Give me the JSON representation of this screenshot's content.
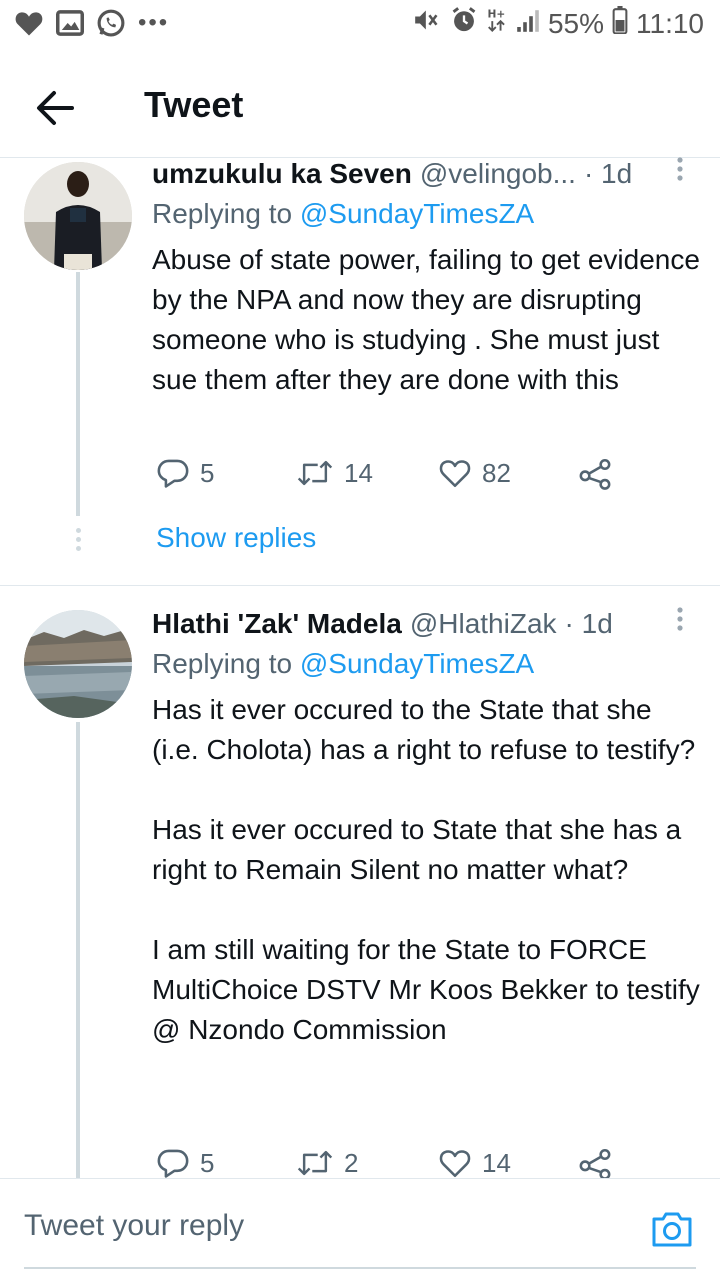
{
  "status_bar": {
    "battery": "55%",
    "time": "11:10",
    "overflow": "•••"
  },
  "header": {
    "title": "Tweet"
  },
  "tweets": [
    {
      "name": "umzukulu ka Seven",
      "handle": "@velingob...",
      "time": "· 1d",
      "replying_prefix": "Replying to ",
      "replying_to": "@SundayTimesZA",
      "body": "Abuse of state power, failing to get evidence by the NPA and now they are disrupting someone who is studying . She must just sue them after they are done with this",
      "replies": "5",
      "retweets": "14",
      "likes": "82",
      "show_replies": "Show replies"
    },
    {
      "name": "Hlathi 'Zak' Madela",
      "handle": "@HlathiZak",
      "time": "· 1d",
      "replying_prefix": "Replying to ",
      "replying_to": "@SundayTimesZA",
      "body": "Has it ever occured to the State that she (i.e. Cholota) has a right to refuse to testify?\n\nHas it ever occured to State that she has a right to Remain Silent no matter what?\n\nI am still waiting for the State to FORCE MultiChoice DSTV Mr Koos Bekker to testify @ Nzondo Commission",
      "replies": "5",
      "retweets": "2",
      "likes": "14"
    }
  ],
  "reply_bar": {
    "placeholder": "Tweet your reply"
  },
  "colors": {
    "accent": "#1d9bf0",
    "text": "#0f1419",
    "secondary": "#536471",
    "thread_line": "#cfd9de"
  }
}
